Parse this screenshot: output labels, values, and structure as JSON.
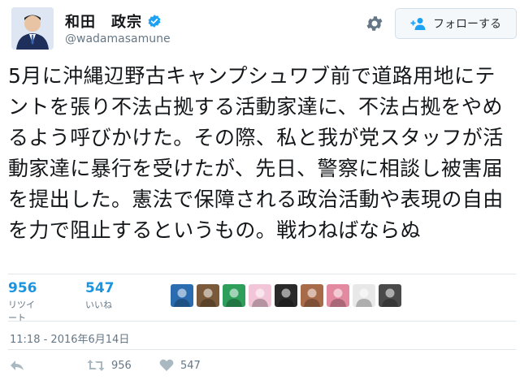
{
  "header": {
    "display_name": "和田　政宗",
    "handle": "@wadamasamune",
    "follow_label": "フォローする"
  },
  "tweet": {
    "text": "5月に沖縄辺野古キャンプシュワブ前で道路用地にテントを張り不法占拠する活動家達に、不法占拠をやめるよう呼びかけた。その際、私と我が党スタッフが活動家達に暴行を受けたが、先日、警察に相談し被害届を提出した。憲法で保障される政治活動や表現の自由を力で阻止するというもの。戦わねばならぬ",
    "timestamp": "11:18 - 2016年6月14日"
  },
  "stats": {
    "retweets_count": "956",
    "retweets_label": "リツイート",
    "likes_count": "547",
    "likes_label": "いいね"
  },
  "actions": {
    "retweet_count": "956",
    "like_count": "547"
  },
  "liker_faces": [
    {
      "icon": "avatar-blue-abstract",
      "color": "#2b6cb0"
    },
    {
      "icon": "avatar-man-glasses",
      "color": "#7a5a3a"
    },
    {
      "icon": "avatar-green-sign",
      "color": "#2e9e5b"
    },
    {
      "icon": "avatar-anime-girl",
      "color": "#f2c6d8"
    },
    {
      "icon": "avatar-white-cat",
      "color": "#2a2a2a"
    },
    {
      "icon": "avatar-old-man",
      "color": "#a86b4a"
    },
    {
      "icon": "avatar-anime-pink",
      "color": "#e38aa0"
    },
    {
      "icon": "avatar-man-suit",
      "color": "#e8e8e8"
    },
    {
      "icon": "avatar-man-dark",
      "color": "#4a4a4a"
    }
  ],
  "colors": {
    "accent": "#1b95e0",
    "verified": "#1da1f2",
    "muted": "#657786"
  }
}
